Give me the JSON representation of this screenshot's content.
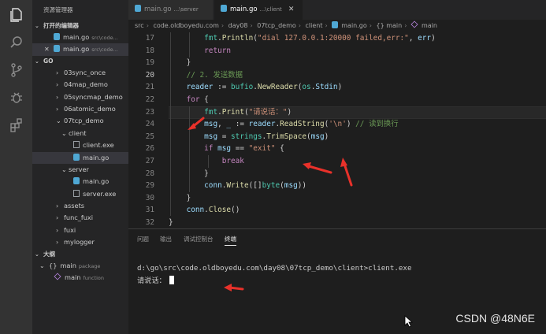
{
  "activity_bar": {
    "icons": [
      "files-icon",
      "search-icon",
      "source-control-icon",
      "debug-icon",
      "extensions-icon"
    ]
  },
  "sidebar": {
    "title": "资源管理器",
    "open_editors": {
      "label": "打开的编辑器",
      "items": [
        {
          "name": "main.go",
          "path": "src\\code..."
        },
        {
          "name": "main.go",
          "path": "src\\code..."
        }
      ]
    },
    "go_section": {
      "label": "GO",
      "items": [
        {
          "label": "03sync_once"
        },
        {
          "label": "04map_demo"
        },
        {
          "label": "05syncmap_demo"
        },
        {
          "label": "06atomic_demo"
        },
        {
          "label": "07tcp_demo"
        },
        {
          "label": "client"
        },
        {
          "label": "client.exe"
        },
        {
          "label": "main.go"
        },
        {
          "label": "server"
        },
        {
          "label": "main.go"
        },
        {
          "label": "server.exe"
        },
        {
          "label": "assets"
        },
        {
          "label": "func_fuxi"
        },
        {
          "label": "fuxi"
        },
        {
          "label": "mylogger"
        }
      ]
    },
    "outline": {
      "label": "大纲",
      "items": [
        {
          "name": "main",
          "kind": "package"
        },
        {
          "name": "main",
          "kind": "function"
        }
      ]
    }
  },
  "tabs": [
    {
      "label": "main.go",
      "sub": "...\\server"
    },
    {
      "label": "main.go",
      "sub": "...\\client"
    }
  ],
  "breadcrumb": [
    "src",
    "code.oldboyedu.com",
    "day08",
    "07tcp_demo",
    "client",
    "main.go",
    "{} main",
    "main"
  ],
  "editor": {
    "current_line": 20,
    "lines": [
      {
        "n": "17",
        "code": "        fmt.Println(\"dial 127.0.0.1:20000 failed,err:\", err)"
      },
      {
        "n": "18",
        "code": "        return"
      },
      {
        "n": "19",
        "code": "    }"
      },
      {
        "n": "20",
        "code": "    // 2. 发送数据"
      },
      {
        "n": "21",
        "code": "    reader := bufio.NewReader(os.Stdin)"
      },
      {
        "n": "22",
        "code": "    for {"
      },
      {
        "n": "23",
        "code": "        fmt.Print(\"请说话：\")"
      },
      {
        "n": "24",
        "code": "        msg, _ := reader.ReadString('\\n') // 读到换行"
      },
      {
        "n": "25",
        "code": "        msg = strings.TrimSpace(msg)"
      },
      {
        "n": "26",
        "code": "        if msg == \"exit\" {"
      },
      {
        "n": "27",
        "code": "            break"
      },
      {
        "n": "28",
        "code": "        }"
      },
      {
        "n": "29",
        "code": "        conn.Write([]byte(msg))"
      },
      {
        "n": "30",
        "code": "    }"
      },
      {
        "n": "31",
        "code": "    conn.Close()"
      },
      {
        "n": "32",
        "code": "}"
      }
    ]
  },
  "panel": {
    "tabs": [
      "问题",
      "输出",
      "调试控制台",
      "终端"
    ],
    "active_tab": "终端",
    "terminal_lines": [
      "d:\\go\\src\\code.oldboyedu.com\\day08\\07tcp_demo\\client>client.exe",
      "请说话："
    ]
  },
  "watermark": "CSDN @48N6E",
  "colors": {
    "keyword": "#c586c0",
    "function": "#dcdcaa",
    "string": "#ce9178",
    "comment": "#6a9955",
    "variable": "#9cdcfe",
    "type": "#4ec9b0",
    "annotation": "#e8312a"
  }
}
